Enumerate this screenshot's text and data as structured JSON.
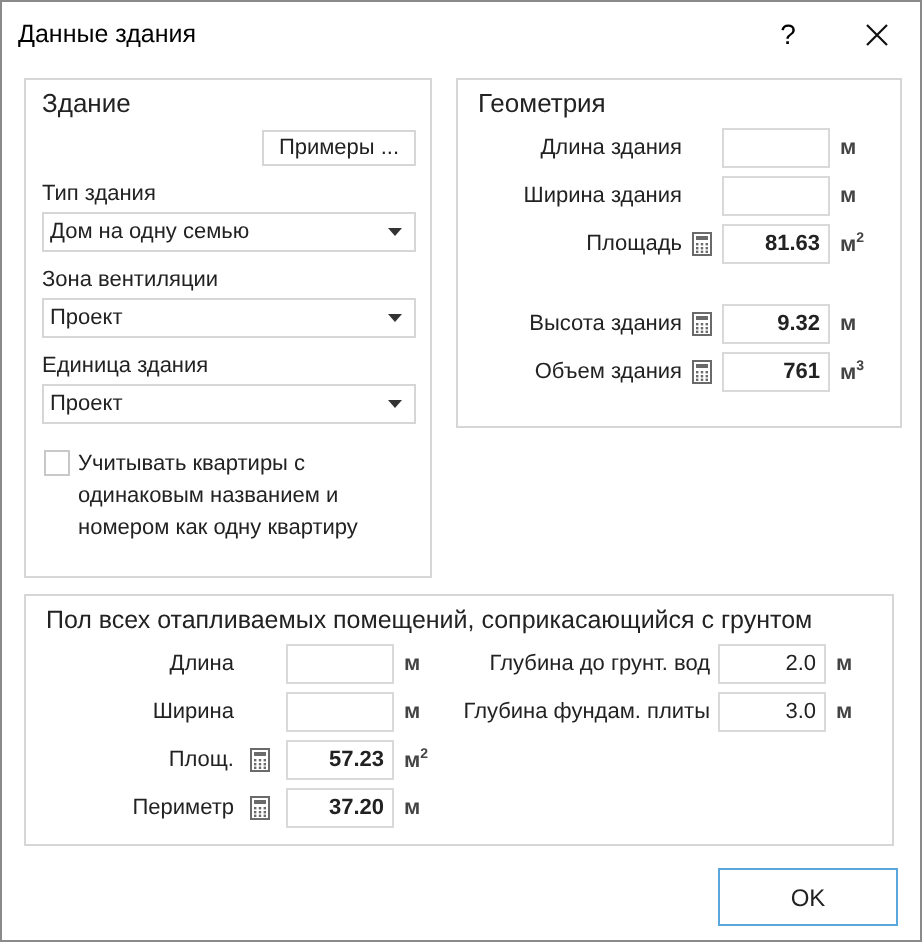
{
  "window": {
    "title": "Данные здания",
    "help": "?"
  },
  "building": {
    "title": "Здание",
    "examples_button": "Примеры ...",
    "dropdowns": [
      {
        "label": "Тип здания",
        "value": "Дом на одну семью"
      },
      {
        "label": "Зона вентиляции",
        "value": "Проект"
      },
      {
        "label": "Единица здания",
        "value": "Проект"
      }
    ],
    "checkbox": {
      "label": "Учитывать квартиры с одинаковым названием и номером как одну квартиру",
      "checked": false
    }
  },
  "geometry": {
    "title": "Геометрия",
    "groups": [
      {
        "rows": [
          {
            "label": "Длина здания",
            "kind": "input",
            "unit": "м"
          },
          {
            "label": "Ширина здания",
            "kind": "input",
            "unit": "м"
          },
          {
            "label": "Площадь",
            "kind": "computed",
            "value": "81.63",
            "unit": "м$^{2}$"
          }
        ]
      },
      {
        "rows": [
          {
            "label": "Высота здания",
            "kind": "computed",
            "value": "9.32",
            "unit": "м"
          },
          {
            "label": "Объем здания",
            "kind": "computed",
            "value": "761",
            "unit": "м$^{3}$"
          }
        ]
      }
    ]
  },
  "floor": {
    "title": "Пол всех отапливаемых помещений, соприкасающийся с грунтом",
    "left_rows": [
      {
        "label": "Длина",
        "kind": "input",
        "unit": "м"
      },
      {
        "label": "Ширина",
        "kind": "input",
        "unit": "м"
      },
      {
        "label": "Площ.",
        "kind": "computed",
        "value": "57.23",
        "unit": "м$^{2}$"
      },
      {
        "label": "Периметр",
        "kind": "computed",
        "value": "37.20",
        "unit": "м"
      }
    ],
    "right_rows": [
      {
        "label": "Глубина до грунт. вод",
        "kind": "input",
        "value": "2.0",
        "unit": "м"
      },
      {
        "label": "Глубина фундам. плиты",
        "kind": "input",
        "value": "3.0",
        "unit": "м"
      }
    ]
  },
  "buttons": [
    "OK"
  ]
}
